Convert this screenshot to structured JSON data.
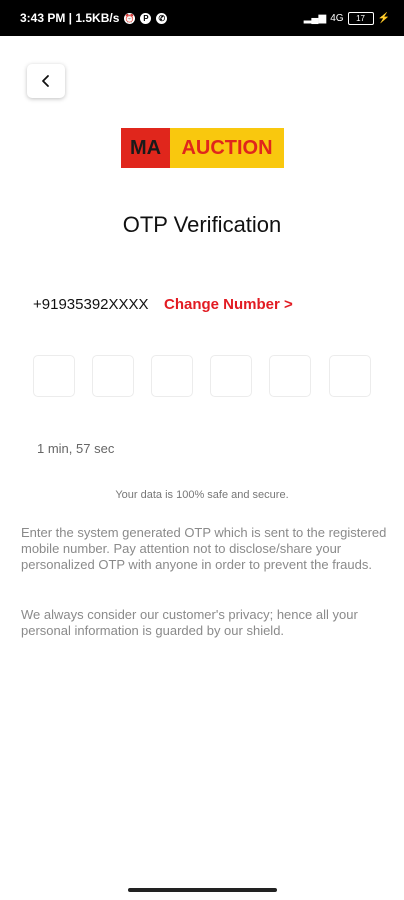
{
  "status_bar": {
    "time": "3:43 PM | 1.5KB/s",
    "signal": "4G",
    "battery": "17"
  },
  "logo": {
    "left_text": "MA",
    "right_text": "AUCTION",
    "left_color": "#e0261c",
    "right_color": "#f9c80e"
  },
  "page": {
    "title": "OTP Verification",
    "phone_number": "+91935392XXXX",
    "change_number_label": "Change Number >",
    "otp_boxes": 6,
    "timer": "1 min, 57 sec",
    "safe_note": "Your data is 100% safe and secure.",
    "paragraph1": "Enter the system generated OTP which is sent to the registered mobile number. Pay attention not to disclose/share your personalized OTP with anyone in order to prevent the frauds.",
    "paragraph2": "We always consider our customer's privacy; hence all your personal information is guarded by our shield."
  },
  "colors": {
    "accent": "#e21b22"
  }
}
